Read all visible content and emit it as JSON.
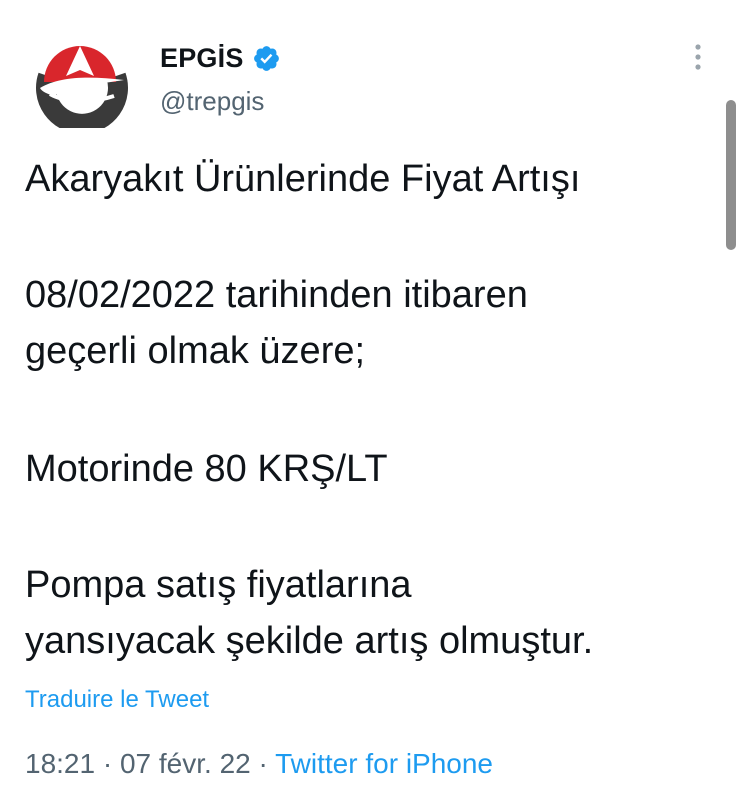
{
  "author": {
    "display_name": "EPGİS",
    "handle": "@trepgis",
    "verified": true,
    "avatar_icon": "epgis-logo-icon"
  },
  "tweet": {
    "lines": {
      "title": "Akaryakıt Ürünlerinde Fiyat Artışı",
      "date_line_1": "08/02/2022 tarihinden itibaren",
      "date_line_2": "geçerli olmak üzere;",
      "diesel": "Motorinde 80 KRŞ/LT",
      "pump_line_1": "Pompa satış fiyatlarına",
      "pump_line_2": "yansıyacak şekilde artış olmuştur."
    },
    "translate_label": "Traduire le Tweet"
  },
  "meta": {
    "time": "18:21",
    "separator": " · ",
    "date": "07 févr. 22",
    "source": "Twitter for iPhone"
  },
  "colors": {
    "accent": "#1d9bf0",
    "text": "#0f1419",
    "secondary": "#536471",
    "logo_red": "#d9262c",
    "logo_dark": "#3a3a3a"
  }
}
